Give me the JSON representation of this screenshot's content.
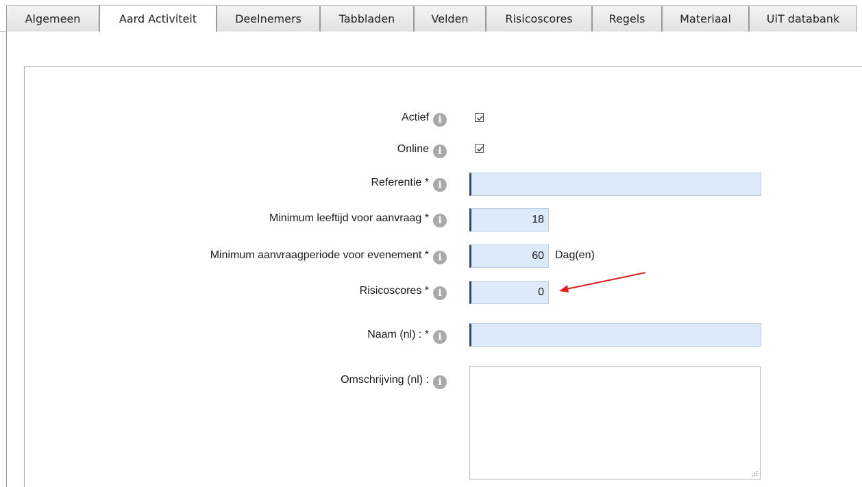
{
  "tabs": [
    {
      "label": "Algemeen",
      "active": false
    },
    {
      "label": "Aard Activiteit",
      "active": true
    },
    {
      "label": "Deelnemers",
      "active": false
    },
    {
      "label": "Tabbladen",
      "active": false
    },
    {
      "label": "Velden",
      "active": false
    },
    {
      "label": "Risicoscores",
      "active": false
    },
    {
      "label": "Regels",
      "active": false
    },
    {
      "label": "Materiaal",
      "active": false
    },
    {
      "label": "UiT databank",
      "active": false
    }
  ],
  "form": {
    "actief": {
      "label": "Actief",
      "checked": true
    },
    "online": {
      "label": "Online",
      "checked": true
    },
    "referentie": {
      "label": "Referentie *",
      "value": ""
    },
    "min_leeftijd": {
      "label": "Minimum leeftijd voor aanvraag *",
      "value": "18"
    },
    "min_periode": {
      "label": "Minimum aanvraagperiode voor evenement *",
      "value": "60",
      "unit": "Dag(en)"
    },
    "risicoscores": {
      "label": "Risicoscores *",
      "value": "0"
    },
    "naam": {
      "label": "Naam (nl) : *",
      "value": ""
    },
    "omschrijving": {
      "label": "Omschrijving (nl) :",
      "value": ""
    }
  },
  "info_icon": "info-icon",
  "colors": {
    "field_bg": "#ddeafb",
    "annotation_arrow": "#e02020"
  }
}
